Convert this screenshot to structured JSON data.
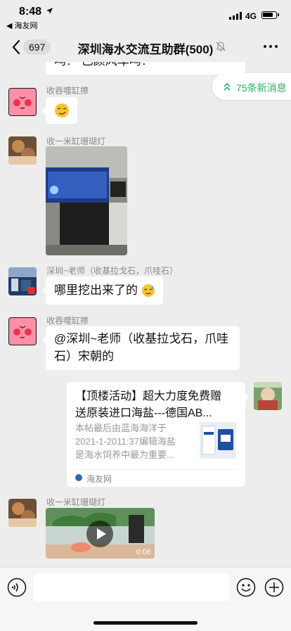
{
  "status_bar": {
    "time": "8:48",
    "back_app": "◀ 海友网",
    "network": "4G"
  },
  "nav": {
    "back_badge": "697",
    "title": "深圳海水交流互助群(500)"
  },
  "new_messages": {
    "label": "75条新消息"
  },
  "messages": [
    {
      "type": "text",
      "sender": "",
      "text": "吗？ 已颜风车吗？"
    },
    {
      "type": "emoji",
      "sender": "收吞噬缸擦",
      "text": ""
    },
    {
      "type": "image",
      "sender": "收一米缸珊瑚灯",
      "text": ""
    },
    {
      "type": "text",
      "sender": "深圳~老师（收基拉戈石，爪哇石）",
      "text": "哪里挖出来了的"
    },
    {
      "type": "text",
      "sender": "收吞噬缸擦",
      "line1": "@深圳~老师（收基拉戈石，爪哇",
      "line2": "石）宋朝的"
    },
    {
      "type": "link",
      "sender": "",
      "title_line1": "【顶楼活动】超大力度免费赠",
      "title_line2": "送原装进口海盐---德国AB...",
      "desc_line1": "本帖最后由蓝海海洋于",
      "desc_line2": "2021-1-2011:37编辑海盐",
      "desc_line3": "是海水饲养中最为重要...",
      "source": "海友网"
    },
    {
      "type": "video",
      "sender": "收一米缸珊瑚灯",
      "duration": "0:06"
    }
  ],
  "colors": {
    "accent": "#2aae67",
    "chat_bg": "#ededed",
    "bubble": "#ffffff"
  }
}
